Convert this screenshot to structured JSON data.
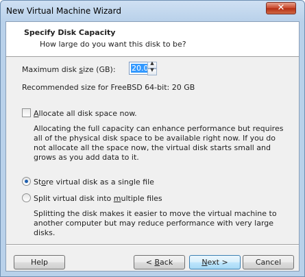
{
  "window": {
    "title": "New Virtual Machine Wizard",
    "close_glyph": "✕"
  },
  "header": {
    "title": "Specify Disk Capacity",
    "subtitle": "How large do you want this disk to be?"
  },
  "disk_size": {
    "label_pre": "Maximum disk ",
    "label_accel": "s",
    "label_post": "ize (GB):",
    "value": "20.0",
    "recommended": "Recommended size for FreeBSD 64-bit: 20 GB"
  },
  "allocate": {
    "label_accel": "A",
    "label_post": "llocate all disk space now.",
    "checked": false,
    "description": "Allocating the full capacity can enhance performance but requires all of the physical disk space to be available right now. If you do not allocate all the space now, the virtual disk starts small and grows as you add data to it."
  },
  "storage_options": {
    "single_pre": "St",
    "single_accel": "o",
    "single_post": "re virtual disk as a single file",
    "multiple_pre": "Split virtual disk into ",
    "multiple_accel": "m",
    "multiple_post": "ultiple files",
    "selected": "single",
    "multiple_description": "Splitting the disk makes it easier to move the virtual machine to another computer but may reduce performance with very large disks."
  },
  "buttons": {
    "help": "Help",
    "back_pre": "< ",
    "back_accel": "B",
    "back_post": "ack",
    "next_accel": "N",
    "next_post": "ext >",
    "cancel": "Cancel"
  },
  "colors": {
    "selection": "#3399ff",
    "radio_dot": "#1f5fae",
    "close_button": "#c7452a"
  }
}
